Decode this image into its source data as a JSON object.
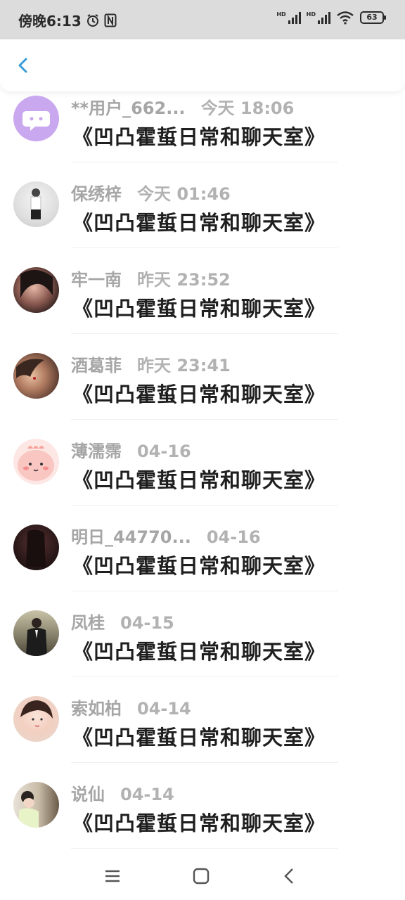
{
  "status_bar": {
    "time": "傍晚6:13",
    "hd1": "HD",
    "hd2": "HD",
    "battery": "63",
    "icons": [
      "alarm-icon",
      "nfc-icon",
      "signal-icon",
      "signal-icon",
      "wifi-icon",
      "battery-icon"
    ]
  },
  "header": {
    "back_icon": "chevron-left-icon",
    "accent": "#3a9bd9"
  },
  "comments": [
    {
      "user": "**用户_662...",
      "time": "今天 18:06",
      "message": "《凹凸霍蜇日常和聊天室》",
      "avatar_color": "#c9a8ef"
    },
    {
      "user": "保绣梓",
      "time": "今天 01:46",
      "message": "《凹凸霍蜇日常和聊天室》",
      "avatar_color": "#d8d8d8"
    },
    {
      "user": "牢一南",
      "time": "昨天 23:52",
      "message": "《凹凸霍蜇日常和聊天室》",
      "avatar_color": "#3b2a2a"
    },
    {
      "user": "酒葛菲",
      "time": "昨天 23:41",
      "message": "《凹凸霍蜇日常和聊天室》",
      "avatar_color": "#7a5040"
    },
    {
      "user": "薄濡霈",
      "time": "04-16",
      "message": "《凹凸霍蜇日常和聊天室》",
      "avatar_color": "#f7c9c9"
    },
    {
      "user": "明日_44770...",
      "time": "04-16",
      "message": "《凹凸霍蜇日常和聊天室》",
      "avatar_color": "#3a2424"
    },
    {
      "user": "凤桂",
      "time": "04-15",
      "message": "《凹凸霍蜇日常和聊天室》",
      "avatar_color": "#4a4a3a"
    },
    {
      "user": "索如柏",
      "time": "04-14",
      "message": "《凹凸霍蜇日常和聊天室》",
      "avatar_color": "#f0dcd2"
    },
    {
      "user": "说仙",
      "time": "04-14",
      "message": "《凹凸霍蜇日常和聊天室》",
      "avatar_color": "#9a8a7a"
    }
  ],
  "nav_bar": {
    "icons": [
      "menu-icon",
      "home-icon",
      "back-icon"
    ]
  }
}
